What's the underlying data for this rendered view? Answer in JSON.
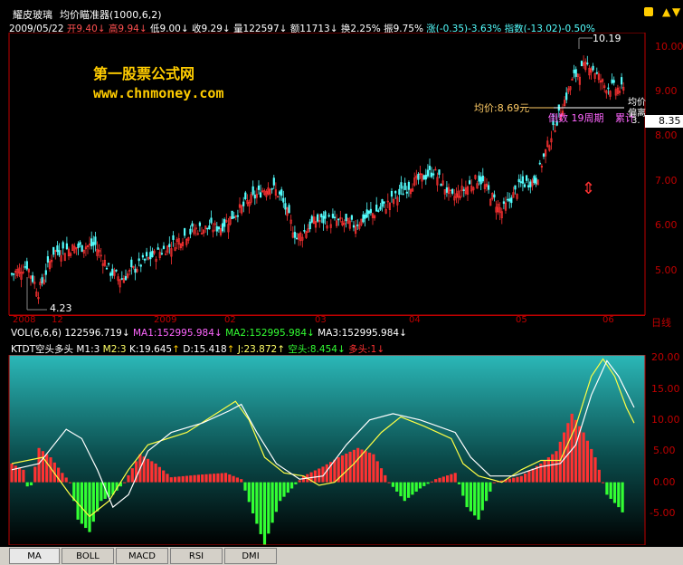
{
  "header": {
    "title": "耀皮玻璃",
    "indicator": "均价瞄准器(1000,6,2)",
    "date": "2009/05/22",
    "open": "开9.40",
    "high": "高9.94",
    "low": "低9.00",
    "close": "收9.29",
    "volume": "量122597",
    "amount": "额11713",
    "turnover": "换2.25%",
    "amplitude": "振9.75%",
    "change": "涨(-0.35)-3.63%",
    "index": "指数(-13.02)-0.50%"
  },
  "watermark": {
    "line1": "第一股票公式网",
    "line2": "www.chnmoney.com"
  },
  "price_panel": {
    "ticks": [
      "10.00",
      "9.00",
      "8.00",
      "7.00",
      "6.00",
      "5.00"
    ],
    "current_price": "8.35",
    "high_label": "10.19",
    "low_label": "4.23",
    "avg_label": "均价:8.69元",
    "countdown_label": "倒数 19周期",
    "accum_label": "累计",
    "right_label_a": "均价",
    "right_label_b": "偏离",
    "right_label_c": "3.",
    "arrow_icon": "double-arrow"
  },
  "date_axis": {
    "labels": [
      "2008",
      "12",
      "2009",
      "02",
      "03",
      "04",
      "05",
      "06"
    ],
    "right_label": "日线"
  },
  "volume_line": {
    "name": "VOL(6,6,6)",
    "value": "122596.719",
    "ma1": "MA1:152995.984",
    "ma2": "MA2:152995.984",
    "ma3": "MA3:152995.984"
  },
  "kd_line": {
    "name": "KTDT空头多头",
    "m1": "M1:3",
    "m2": "M2:3",
    "k": "K:19.645",
    "d": "D:15.418",
    "j": "J:23.872",
    "kong": "空头:8.454",
    "duo": "多头:1"
  },
  "osc_panel": {
    "ticks": [
      "20.00",
      "15.00",
      "10.00",
      "5.00",
      "0.00",
      "-5.00"
    ]
  },
  "tabs": [
    "MA",
    "BOLL",
    "MACD",
    "RSI",
    "DMI"
  ],
  "colors": {
    "up": "#ff3232",
    "down": "#54ffff",
    "axis": "#c00000",
    "watermark": "#ffcc00",
    "osc_green": "#33ff33"
  }
}
